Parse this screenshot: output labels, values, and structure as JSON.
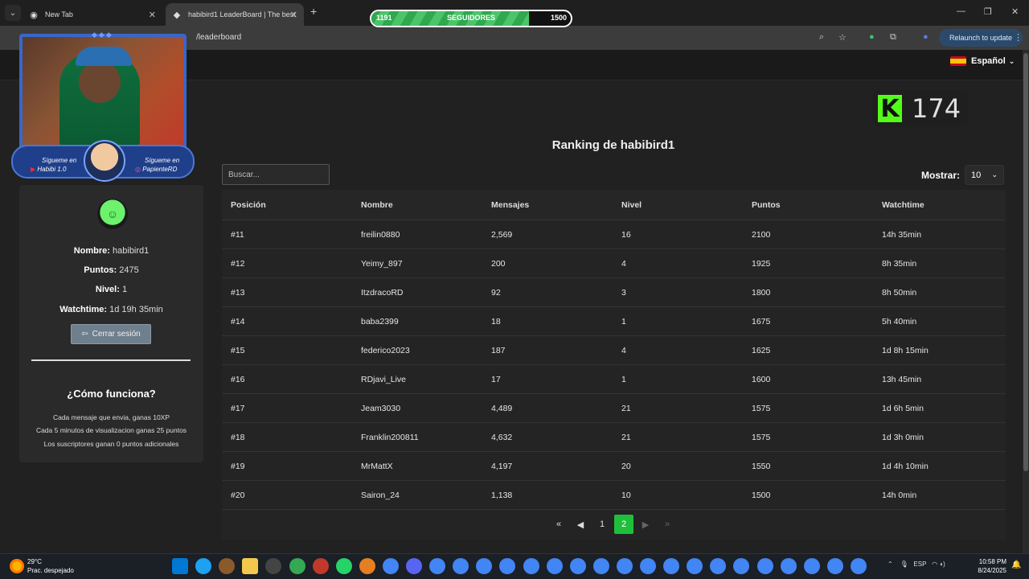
{
  "browser": {
    "tabs": [
      {
        "title": "New Tab"
      },
      {
        "title": "habibird1 LeaderBoard | The best"
      }
    ],
    "url": "/leaderboard",
    "relaunch_label": "Relaunch to update"
  },
  "overlay": {
    "followers": {
      "current": "1191",
      "label": "SEGUIDORES",
      "goal": "1500",
      "progress": 0.79
    },
    "kick_count": "174",
    "cam": {
      "follow_label_left": "Sígueme en",
      "channel_left": "Habibi 1.0",
      "follow_label_right": "Sígueme en",
      "channel_right": "PapienteRD"
    }
  },
  "header": {
    "language": "Español"
  },
  "profile": {
    "name_label": "Nombre:",
    "name": "habibird1",
    "points_label": "Puntos:",
    "points": "2475",
    "level_label": "Nivel:",
    "level": "1",
    "watchtime_label": "Watchtime:",
    "watchtime": "1d 19h 35min",
    "logout_label": "Cerrar sesión"
  },
  "how": {
    "title": "¿Cómo funciona?",
    "lines": [
      "Cada mensaje que envia, ganas 10XP",
      "Cada 5 minutos de visualizacion ganas 25 puntos",
      "Los suscriptores ganan 0 puntos adicionales"
    ]
  },
  "main": {
    "title": "Ranking de habibird1",
    "search_placeholder": "Buscar...",
    "show_label": "Mostrar:",
    "show_value": "10",
    "columns": [
      "Posición",
      "Nombre",
      "Mensajes",
      "Nivel",
      "Puntos",
      "Watchtime"
    ],
    "rows": [
      [
        "#11",
        "freilin0880",
        "2,569",
        "16",
        "2100",
        "14h 35min"
      ],
      [
        "#12",
        "Yeimy_897",
        "200",
        "4",
        "1925",
        "8h 35min"
      ],
      [
        "#13",
        "ItzdracoRD",
        "92",
        "3",
        "1800",
        "8h 50min"
      ],
      [
        "#14",
        "baba2399",
        "18",
        "1",
        "1675",
        "5h 40min"
      ],
      [
        "#15",
        "federico2023",
        "187",
        "4",
        "1625",
        "1d 8h 15min"
      ],
      [
        "#16",
        "RDjavi_Live",
        "17",
        "1",
        "1600",
        "13h 45min"
      ],
      [
        "#17",
        "Jeam3030",
        "4,489",
        "21",
        "1575",
        "1d 6h 5min"
      ],
      [
        "#18",
        "Franklin200811",
        "4,632",
        "21",
        "1575",
        "1d 3h 0min"
      ],
      [
        "#19",
        "MrMattX",
        "4,197",
        "20",
        "1550",
        "1d 4h 10min"
      ],
      [
        "#20",
        "Sairon_24",
        "1,138",
        "10",
        "1500",
        "14h 0min"
      ]
    ],
    "pages": [
      "1",
      "2"
    ],
    "current_page": "2"
  },
  "taskbar": {
    "temp": "29°C",
    "weather": "Prac. despejado",
    "lang": "ESP",
    "time": "10:58 PM",
    "date": "8/24/2025"
  }
}
